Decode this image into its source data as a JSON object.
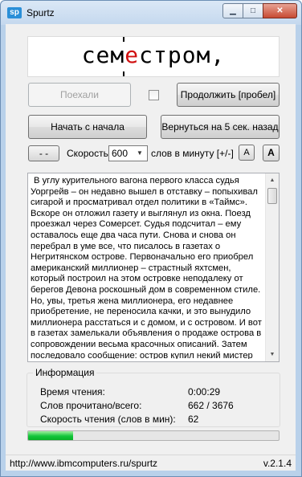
{
  "window": {
    "title": "Spurtz",
    "icon_text": "sp",
    "min_symbol": "▁",
    "max_symbol": "□",
    "close_symbol": "✕"
  },
  "word": {
    "before": "сем",
    "focus": "е",
    "after": "стром,"
  },
  "buttons": {
    "go": "Поехали",
    "continue": "Продолжить [пробел]",
    "restart": "Начать с начала",
    "back5": "Вернуться на 5 сек. назад",
    "minus": "- -",
    "font_smaller": "A",
    "font_larger": "A"
  },
  "speed": {
    "label": "Скорость",
    "value": "600",
    "unit": "слов в минуту [+/-]"
  },
  "checkbox": {
    "checked": false
  },
  "text_body": "В углу курительного вагона первого класса судья Уоргрейв – он недавно вышел в отставку – попыхивал сигарой и просматривал отдел политики в «Таймс». Вскоре он отложил газету и выглянул из окна. Поезд проезжал через Сомерсет. Судья подсчитал – ему оставалось еще два часа пути. Снова и снова он перебрал в уме все, что писалось в газетах о Негритянском острове. Первоначально его приобрел американский миллионер – страстный яхтсмен, который построил на этом островке неподалеку от берегов Девона роскошный дом в современном стиле. Но, увы, третья жена миллионера, его недавнее приобретение, не переносила качки, и это вынудило миллионера расстаться и с домом, и с островом. И вот в газетах замелькали объявления о продаже острова в сопровождении весьма красочных описаний. Затем последовало сообщение: остров купил некий мистер",
  "info": {
    "title": "Информация",
    "rows": [
      {
        "label": "Время чтения:",
        "value": "0:00:29"
      },
      {
        "label": "Слов прочитано/всего:",
        "value": "662 / 3676"
      },
      {
        "label": "Скорость чтения (слов в мин):",
        "value": "62"
      }
    ]
  },
  "progress": {
    "fraction": 0.18,
    "color": "#06b025"
  },
  "status": {
    "url": "http://www.ibmcomputers.ru/spurtz",
    "version": "v.2.1.4"
  }
}
